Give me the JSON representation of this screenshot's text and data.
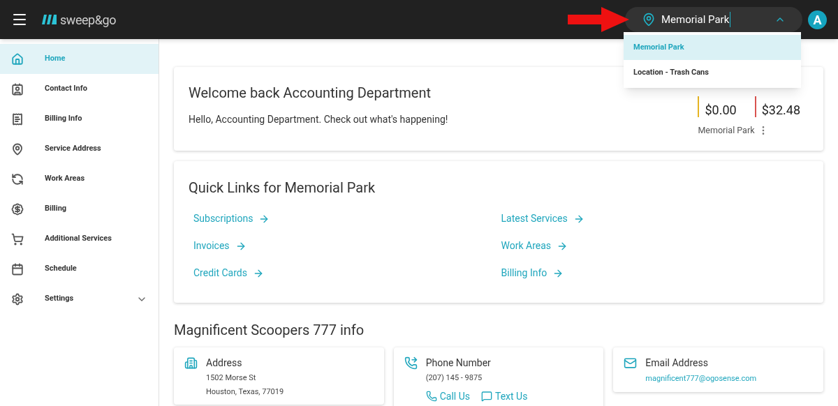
{
  "header": {
    "logo": "sweep&go",
    "location_field": {
      "value": "Memorial Park"
    },
    "avatar": "A"
  },
  "location_menu": [
    {
      "label": "Memorial Park",
      "selected": true
    },
    {
      "label": "Location - Trash Cans",
      "selected": false
    }
  ],
  "sidebar": {
    "items": [
      {
        "label": "Home",
        "selected": true,
        "expandable": false
      },
      {
        "label": "Contact Info",
        "selected": false,
        "expandable": false
      },
      {
        "label": "Billing Info",
        "selected": false,
        "expandable": false
      },
      {
        "label": "Service Address",
        "selected": false,
        "expandable": false
      },
      {
        "label": "Work Areas",
        "selected": false,
        "expandable": false
      },
      {
        "label": "Billing",
        "selected": false,
        "expandable": false
      },
      {
        "label": "Additional Services",
        "selected": false,
        "expandable": false
      },
      {
        "label": "Schedule",
        "selected": false,
        "expandable": false
      },
      {
        "label": "Settings",
        "selected": false,
        "expandable": true
      }
    ]
  },
  "welcome": {
    "title": "Welcome back Accounting Department",
    "message": "Hello, Accounting Department. Check out what's happening!",
    "balances": [
      {
        "value": "$0.00",
        "color": "#e6b422"
      },
      {
        "value": "$32.48",
        "color": "#d9534f"
      }
    ],
    "location": "Memorial Park"
  },
  "quick_links": {
    "title": "Quick Links for Memorial Park",
    "links": [
      "Subscriptions",
      "Latest Services",
      "Invoices",
      "Work Areas",
      "Credit Cards",
      "Billing Info"
    ]
  },
  "info": {
    "title": "Magnificent Scoopers 777 info",
    "cards": [
      {
        "kind": "address",
        "label": "Address",
        "lines": [
          "1502 Morse St",
          "Houston, Texas, 77019"
        ]
      },
      {
        "kind": "phone",
        "label": "Phone Number",
        "lines": [
          "(207) 145 - 9875"
        ],
        "actions": [
          "Call Us",
          "Text Us"
        ]
      },
      {
        "kind": "email",
        "label": "Email Address",
        "link": "magnificent777@ogosense.com"
      }
    ]
  }
}
